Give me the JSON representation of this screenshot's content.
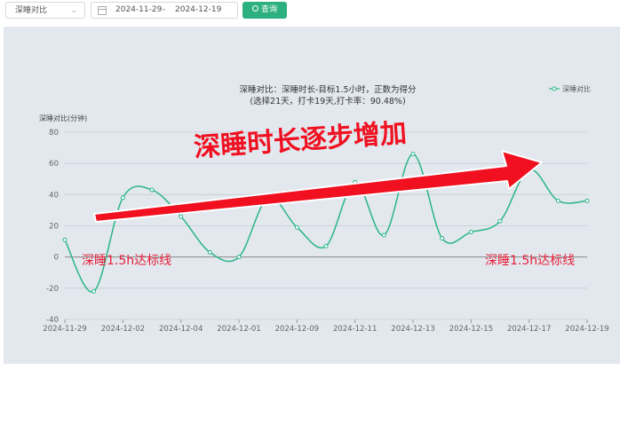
{
  "toolbar": {
    "select_value": "深睡对比",
    "date_start": "2024-11-29",
    "date_separator": "-",
    "date_end": "2024-12-19",
    "query_label": "查询",
    "accent_color": "#2db07f"
  },
  "chart_data": {
    "type": "line",
    "title": "深睡对比：深睡时长-目标1.5小时，正数为得分",
    "subtitle": "(选择21天，打卡19天,打卡率：90.48%)",
    "ylabel": "深睡对比(分钟)",
    "xlabel": "",
    "ylim": [
      -40,
      80
    ],
    "yticks": [
      -40,
      -20,
      0,
      20,
      40,
      60,
      80
    ],
    "x_tick_labels": [
      "2024-11-29",
      "2024-12-02",
      "2024-12-04",
      "2024-12-01",
      "2024-12-09",
      "2024-12-11",
      "2024-12-13",
      "2024-12-15",
      "2024-12-17",
      "2024-12-19"
    ],
    "legend": {
      "position": "top-right",
      "label": "深睡对比"
    },
    "grid": true,
    "smooth": true,
    "series": [
      {
        "name": "深睡对比",
        "color": "#2ab586",
        "values": [
          11,
          -22,
          38,
          43,
          26,
          3,
          0,
          38,
          19,
          7,
          48,
          14,
          66,
          12,
          16,
          23,
          56,
          36,
          36
        ]
      }
    ],
    "annotations": {
      "headline": "深睡时长逐步增加",
      "left_note": "深睡1.5h达标线",
      "right_note": "深睡1.5h达标线",
      "arrow_color": "#f01020"
    }
  }
}
